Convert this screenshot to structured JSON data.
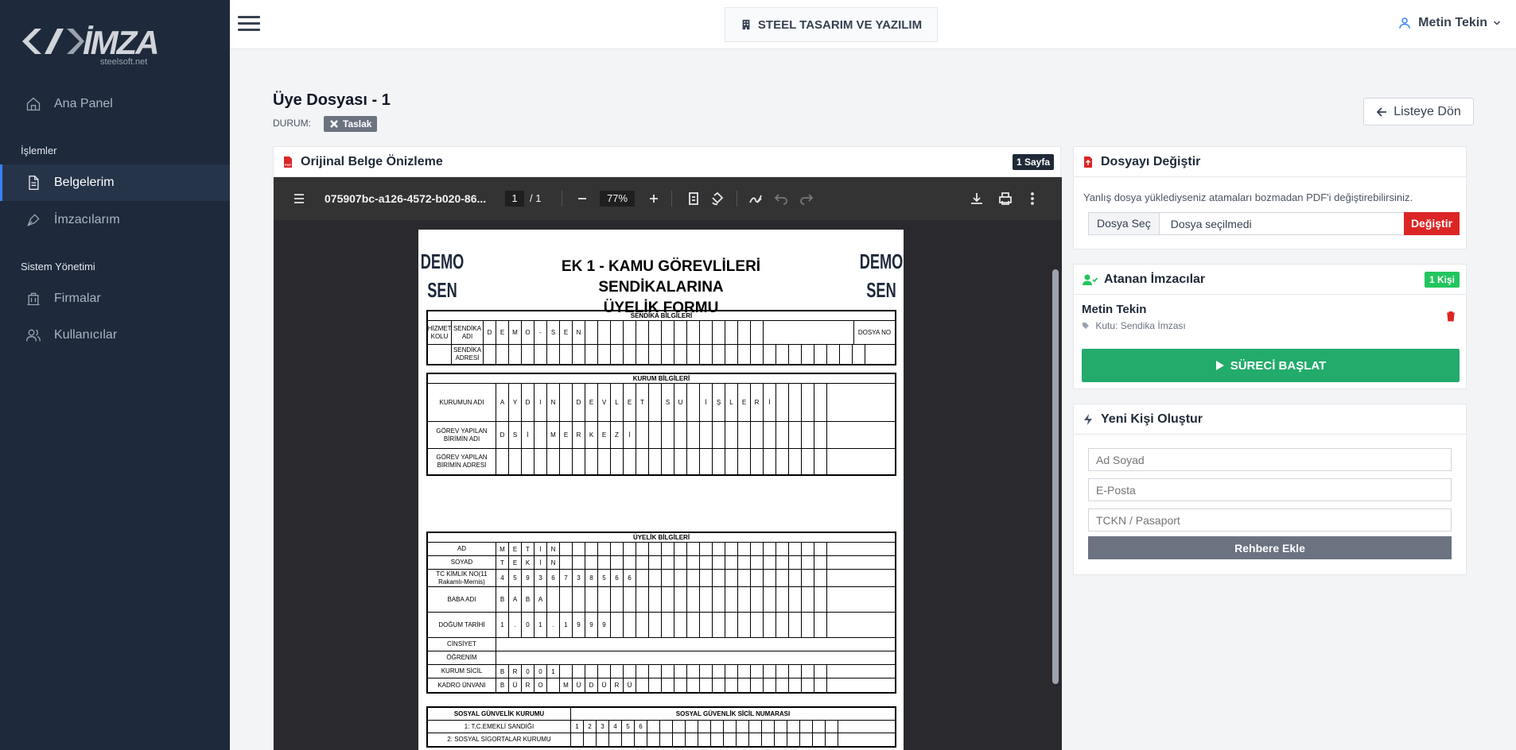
{
  "sidebar": {
    "logo_text": "İMZA",
    "logo_sub": "steelsoft.net",
    "items": [
      {
        "label": "Ana Panel"
      },
      {
        "label": "Belgelerim"
      },
      {
        "label": "İmzacılarım"
      },
      {
        "label": "Firmalar"
      },
      {
        "label": "Kullanıcılar"
      }
    ],
    "sections": [
      "İşlemler",
      "Sistem Yönetimi"
    ]
  },
  "topbar": {
    "company": "STEEL TASARIM VE YAZILIM",
    "user": "Metin Tekin"
  },
  "page": {
    "title": "Üye Dosyası - 1",
    "status_label": "DURUM:",
    "status": "Taslak",
    "back_label": "Listeye Dön"
  },
  "preview": {
    "title": "Orijinal Belge Önizleme",
    "pages_badge": "1 Sayfa",
    "filename": "075907bc-a126-4572-b020-86...",
    "page_current": "1",
    "page_total": "/  1",
    "zoom": "77%"
  },
  "form": {
    "demo_left": "DEMO SEN",
    "demo_right": "DEMO SEN",
    "title_line1": "EK 1 - KAMU GÖREVLİLERİ SENDİKALARINA",
    "title_line2": "ÜYELİK FORMU",
    "sendika_header": "SENDİKA BİLGİLERİ",
    "kurum_header": "KURUM BİLGİLERİ",
    "uyelik_header": "ÜYELİK BİLGİLERİ",
    "sgk_header_left": "SOSYAL GÜNVELİK KURUMU",
    "sgk_header_right": "SOSYAL GÜVENLİK SİCİL NUMARASI",
    "rows": {
      "hizmet_kolu": "HİZMET KOLU",
      "sendika_adi": "SENDİKA ADI",
      "sendika_adi_val": [
        "D",
        "E",
        "M",
        "O",
        "-",
        "S",
        "E",
        "N"
      ],
      "dosya_no": "DOSYA NO",
      "sendika_adresi": "SENDİKA ADRESİ",
      "kurumun_adi": "KURUMUN ADI",
      "kurumun_adi_val": [
        "A",
        "Y",
        "D",
        "I",
        "N",
        " ",
        "D",
        "E",
        "V",
        "L",
        "E",
        "T",
        " ",
        "S",
        "U",
        " ",
        "İ",
        "Ş",
        "L",
        "E",
        "R",
        "İ"
      ],
      "gorev_birim": "GÖREV YAPILAN BİRİMİN ADI",
      "gorev_birim_val": [
        "D",
        "S",
        "İ",
        " ",
        "M",
        "E",
        "R",
        "K",
        "E",
        "Z",
        "İ"
      ],
      "gorev_adres": "GÖREV YAPILAN BİRİMİN ADRESİ",
      "ad": "AD",
      "ad_val": [
        "M",
        "E",
        "T",
        "İ",
        "N"
      ],
      "soyad": "SOYAD",
      "soyad_val": [
        "T",
        "E",
        "K",
        "İ",
        "N"
      ],
      "tc": "TC KİMLİK NO(11 Rakamlı-Mernis)",
      "tc_val": [
        "4",
        "5",
        "9",
        "3",
        "6",
        "7",
        "3",
        "8",
        "5",
        "6",
        "6"
      ],
      "baba": "BABA ADI",
      "baba_val": [
        "B",
        "A",
        "B",
        "A"
      ],
      "dogum": "DOĞUM TARİHİ",
      "dogum_val": [
        "1",
        ".",
        "0",
        "1",
        ".",
        "1",
        "9",
        "9",
        "9"
      ],
      "cinsiyet": "CİNSİYET",
      "ogrenim": "ÖĞRENİM",
      "kurum_sicil": "KURUM SİCİL",
      "kurum_sicil_val": [
        "B",
        "R",
        "0",
        "0",
        "1"
      ],
      "kadro": "KADRO ÜNVANI",
      "kadro_val": [
        "B",
        "Ü",
        "R",
        "O",
        " ",
        "M",
        "Ü",
        "D",
        "Ü",
        "R",
        "Ü"
      ],
      "sgk1": "1: T.C.EMEKLİ SANDIĞI",
      "sgk1_val": [
        "1",
        "2",
        "3",
        "4",
        "5",
        "6"
      ],
      "sgk2": "2: SOSYAL SİGORTALAR KURUMU"
    }
  },
  "change_file": {
    "title": "Dosyayı Değiştir",
    "desc": "Yanlış dosya yüklediyseniz atamaları bozmadan PDF'i değiştirebilirsiniz.",
    "choose": "Dosya Seç",
    "none": "Dosya seçilmedi",
    "button": "Değiştir"
  },
  "signers": {
    "title": "Atanan İmzacılar",
    "badge": "1 Kişi",
    "name": "Metin Tekin",
    "box": "Kutu: Sendika İmzası",
    "start": "SÜRECİ BAŞLAT"
  },
  "new_person": {
    "title": "Yeni Kişi Oluştur",
    "name_ph": "Ad Soyad",
    "email_ph": "E-Posta",
    "tc_ph": "TCKN / Pasaport",
    "button": "Rehbere Ekle"
  },
  "colors": {
    "sidebar": "#1e293b",
    "accent": "#3b82f6",
    "danger": "#dc2626",
    "success": "#22ab6b"
  }
}
